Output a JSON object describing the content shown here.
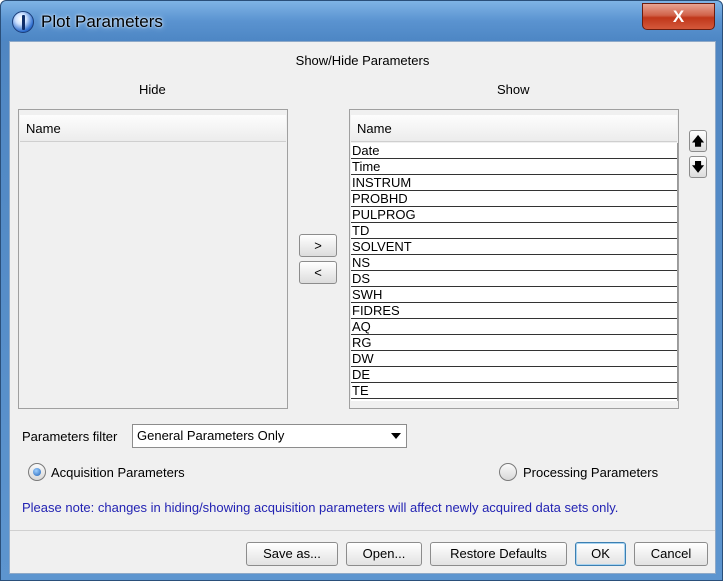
{
  "window": {
    "title": "Plot Parameters",
    "close_label": "X"
  },
  "section_title": "Show/Hide Parameters",
  "hide": {
    "title": "Hide",
    "header": "Name",
    "items": []
  },
  "show": {
    "title": "Show",
    "header": "Name",
    "items": [
      "Date",
      "Time",
      "INSTRUM",
      "PROBHD",
      "PULPROG",
      "TD",
      "SOLVENT",
      "NS",
      "DS",
      "SWH",
      "FIDRES",
      "AQ",
      "RG",
      "DW",
      "DE",
      "TE"
    ]
  },
  "move": {
    "to_show_label": ">",
    "to_hide_label": "<"
  },
  "order": {
    "up_label": "🡅",
    "down_label": "🡇"
  },
  "filter": {
    "label": "Parameters filter",
    "selected": "General Parameters Only"
  },
  "radios": {
    "acquisition": {
      "label": "Acquisition Parameters",
      "checked": true
    },
    "processing": {
      "label": "Processing Parameters",
      "checked": false
    }
  },
  "note": "Please note: changes in hiding/showing acquisition parameters will affect newly acquired data sets only.",
  "buttons": {
    "save_as": "Save as...",
    "open": "Open...",
    "restore": "Restore Defaults",
    "ok": "OK",
    "cancel": "Cancel"
  },
  "colors": {
    "title_bar": "#5a93d0",
    "close_button": "#c0371a",
    "note_text": "#2323b3"
  }
}
